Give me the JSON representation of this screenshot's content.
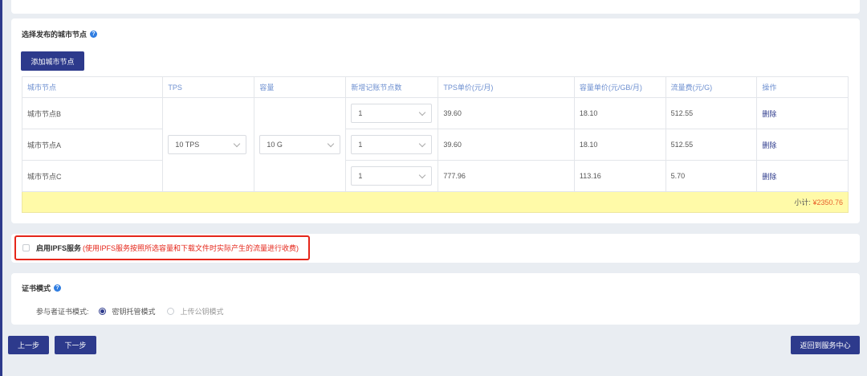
{
  "nodes_section": {
    "title": "选择发布的城市节点",
    "add_button": "添加城市节点",
    "columns": [
      "城市节点",
      "TPS",
      "容量",
      "新增记账节点数",
      "TPS单价(元/月)",
      "容量单价(元/GB/月)",
      "流量费(元/G)",
      "操作"
    ],
    "rows": [
      {
        "city": "城市节点B",
        "nodes": "1",
        "tps_price": "39.60",
        "cap_price": "18.10",
        "traffic": "512.55",
        "action": "删除"
      },
      {
        "city": "城市节点A",
        "nodes": "1",
        "tps_price": "39.60",
        "cap_price": "18.10",
        "traffic": "512.55",
        "action": "删除"
      },
      {
        "city": "城市节点C",
        "nodes": "1",
        "tps_price": "777.96",
        "cap_price": "113.16",
        "traffic": "5.70",
        "action": "删除"
      }
    ],
    "tps_select": "10 TPS",
    "capacity_select": "10 G",
    "subtotal_label": "小计:",
    "subtotal_amount": "¥2350.76"
  },
  "ipfs": {
    "label": "启用IPFS服务",
    "note": "(使用IPFS服务按照所选容量和下载文件时实际产生的流量进行收费)"
  },
  "cert": {
    "title": "证书模式",
    "row_label": "参与者证书模式:",
    "option_1": "密钥托管模式",
    "option_2": "上传公钥模式"
  },
  "footer": {
    "prev": "上一步",
    "next": "下一步",
    "back": "返回到服务中心"
  },
  "colors": {
    "primary": "#2d3a8c",
    "highlight_border": "#e5261a",
    "subtotal_bg": "#fffaa8",
    "subtotal_amount": "#e8612c"
  }
}
